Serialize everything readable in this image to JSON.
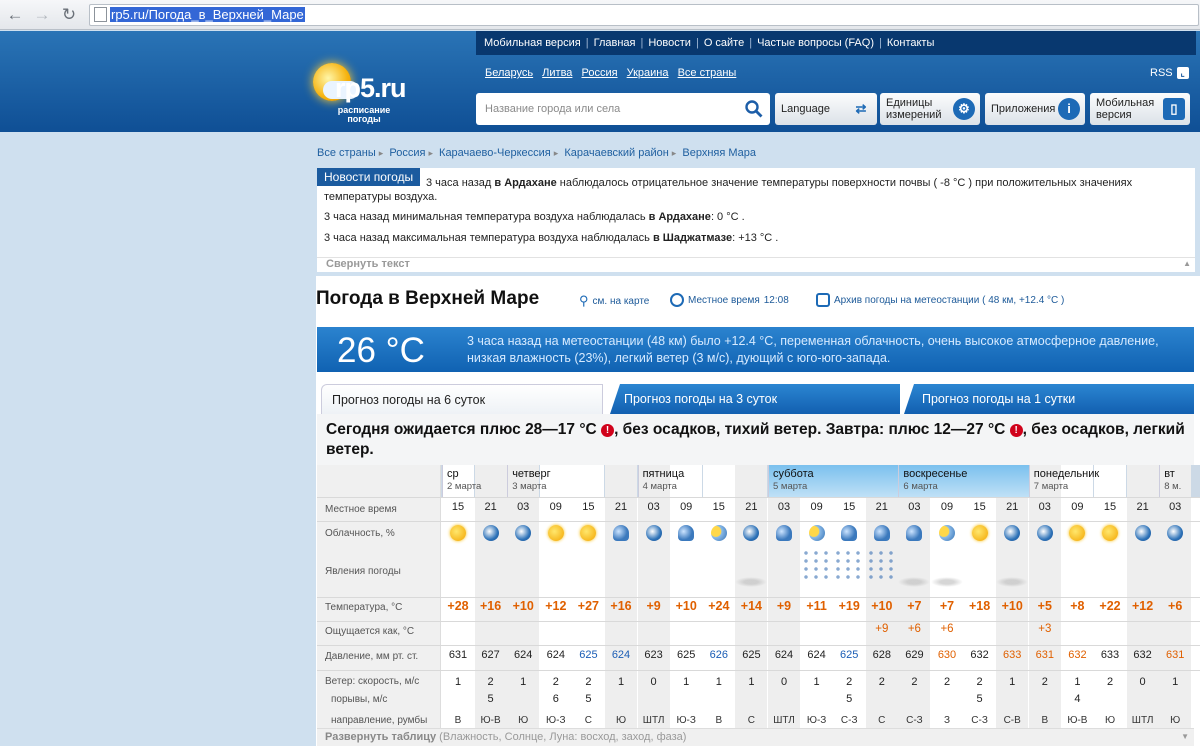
{
  "browser": {
    "url": "rp5.ru/Погода_в_Верхней_Маре"
  },
  "header": {
    "menu": [
      "Мобильная версия",
      "Главная",
      "Новости",
      "О сайте",
      "Частые вопросы (FAQ)",
      "Контакты"
    ],
    "logo": {
      "brand": "rp5.ru",
      "tagline1": "расписание",
      "tagline2": "погоды"
    },
    "countries": [
      "Беларусь",
      "Литва",
      "Россия",
      "Украина",
      "Все страны"
    ],
    "rss": "RSS",
    "search_placeholder": "Название города или села",
    "buttons": {
      "language": "Language",
      "units1": "Единицы",
      "units2": "измерений",
      "apps": "Приложения",
      "mobile1": "Мобильная",
      "mobile2": "версия"
    }
  },
  "breadcrumb": [
    "Все страны",
    "Россия",
    "Карачаево-Черкессия",
    "Карачаевский район",
    "Верхняя Мара"
  ],
  "news": {
    "tag": "Новости погоды",
    "line1a": "3 часа назад ",
    "line1b": "в Ардахане",
    "line1c": " наблюдалось отрицательное значение температуры поверхности почвы ( -8 °C ) при положительных значениях",
    "line1d": "температуры воздуха.",
    "line2a": "3 часа назад минимальная температура воздуха наблюдалась ",
    "line2b": "в Ардахане",
    "line2c": ": 0 °C .",
    "line3a": "3 часа назад максимальная температура воздуха наблюдалась ",
    "line3b": "в Шаджатмазе",
    "line3c": ": +13 °C .",
    "collapse": "Свернуть текст"
  },
  "page": {
    "title": "Погода в Верхней Маре",
    "map_link": "см. на карте",
    "local_time_label": "Местное время",
    "local_time": "12:08",
    "archive": "Архив погоды на метеостанции ( 48 км, +12.4 °C )"
  },
  "now": {
    "temp": "26 °C",
    "text": "3 часа назад на метеостанции (48 км) было +12.4 °C, переменная облачность, очень высокое атмосферное давление, низкая влажность (23%), легкий ветер (3 м/с), дующий с юго-юго-запада."
  },
  "tabs": [
    "Прогноз погоды на 6 суток",
    "Прогноз погоды на 3 суток",
    "Прогноз погоды на 1 сутки"
  ],
  "summary": {
    "p1": "Сегодня ожидается плюс 28—17 °C ",
    "p2": ", без осадков, тихий ветер. Завтра: плюс 12—27 °C ",
    "p3": ", без осадков, легкий ветер.",
    "ex": "!"
  },
  "rows": {
    "time": "Местное время",
    "cloud": "Облачность, %",
    "phen": "Явления погоды",
    "temp": "Температура, °C",
    "feels": "Ощущается как, °C",
    "press": "Давление, мм рт. ст.",
    "wind": "Ветер: скорость, м/с",
    "gust": "порывы, м/с",
    "dir": "направление, румбы"
  },
  "days": [
    {
      "name": "ср",
      "date": "2 марта",
      "hl": false
    },
    {
      "name": "четверг",
      "date": "3 марта",
      "hl": false
    },
    {
      "name": "пятница",
      "date": "4 марта",
      "hl": false
    },
    {
      "name": "суббота",
      "date": "5 марта",
      "hl": true
    },
    {
      "name": "воскресенье",
      "date": "6 марта",
      "hl": true
    },
    {
      "name": "понедельник",
      "date": "7 марта",
      "hl": false
    },
    {
      "name": "вт",
      "date": "8 м.",
      "hl": false
    }
  ],
  "cols": [
    {
      "t": "15",
      "icon": "sun",
      "ph": "",
      "temp": "+28",
      "feels": "",
      "press": "631",
      "pc": "",
      "ws": "1",
      "gs": "",
      "wd": "В",
      "night": false
    },
    {
      "t": "21",
      "icon": "moon",
      "ph": "",
      "temp": "+16",
      "feels": "",
      "press": "627",
      "pc": "",
      "ws": "2",
      "gs": "5",
      "wd": "Ю-В",
      "night": true
    },
    {
      "t": "03",
      "icon": "moon",
      "ph": "",
      "temp": "+10",
      "feels": "",
      "press": "624",
      "pc": "",
      "ws": "1",
      "gs": "",
      "wd": "Ю",
      "night": true
    },
    {
      "t": "09",
      "icon": "sun",
      "ph": "",
      "temp": "+12",
      "feels": "",
      "press": "624",
      "pc": "",
      "ws": "2",
      "gs": "6",
      "wd": "Ю-З",
      "night": false
    },
    {
      "t": "15",
      "icon": "sun",
      "ph": "",
      "temp": "+27",
      "feels": "",
      "press": "625",
      "pc": "blue",
      "ws": "2",
      "gs": "5",
      "wd": "С",
      "night": false
    },
    {
      "t": "21",
      "icon": "cloudy",
      "ph": "",
      "temp": "+16",
      "feels": "",
      "press": "624",
      "pc": "blue",
      "ws": "1",
      "gs": "",
      "wd": "Ю",
      "night": true
    },
    {
      "t": "03",
      "icon": "moon",
      "ph": "",
      "temp": "+9",
      "feels": "",
      "press": "623",
      "pc": "",
      "ws": "0",
      "gs": "",
      "wd": "ШТЛ",
      "night": true
    },
    {
      "t": "09",
      "icon": "cloudy",
      "ph": "",
      "temp": "+10",
      "feels": "",
      "press": "625",
      "pc": "",
      "ws": "1",
      "gs": "",
      "wd": "Ю-З",
      "night": false
    },
    {
      "t": "15",
      "icon": "psun",
      "ph": "",
      "temp": "+24",
      "feels": "",
      "press": "626",
      "pc": "blue",
      "ws": "1",
      "gs": "",
      "wd": "В",
      "night": false
    },
    {
      "t": "21",
      "icon": "moon",
      "ph": "fog",
      "temp": "+14",
      "feels": "",
      "press": "625",
      "pc": "",
      "ws": "1",
      "gs": "",
      "wd": "С",
      "night": true
    },
    {
      "t": "03",
      "icon": "cloudy",
      "ph": "",
      "temp": "+9",
      "feels": "",
      "press": "624",
      "pc": "",
      "ws": "0",
      "gs": "",
      "wd": "ШТЛ",
      "night": true
    },
    {
      "t": "09",
      "icon": "psun",
      "ph": "snow",
      "temp": "+11",
      "feels": "",
      "press": "624",
      "pc": "",
      "ws": "1",
      "gs": "",
      "wd": "Ю-З",
      "night": false
    },
    {
      "t": "15",
      "icon": "cloudy",
      "ph": "snow",
      "temp": "+19",
      "feels": "",
      "press": "625",
      "pc": "blue",
      "ws": "2",
      "gs": "5",
      "wd": "С-З",
      "night": false
    },
    {
      "t": "21",
      "icon": "cloudy",
      "ph": "snow",
      "temp": "+10",
      "feels": "+9",
      "press": "628",
      "pc": "",
      "ws": "2",
      "gs": "",
      "wd": "С",
      "night": true
    },
    {
      "t": "03",
      "icon": "cloudy",
      "ph": "fog",
      "temp": "+7",
      "feels": "+6",
      "press": "629",
      "pc": "",
      "ws": "2",
      "gs": "",
      "wd": "С-З",
      "night": true
    },
    {
      "t": "09",
      "icon": "psun",
      "ph": "fog",
      "temp": "+7",
      "feels": "+6",
      "press": "630",
      "pc": "org",
      "ws": "2",
      "gs": "",
      "wd": "З",
      "night": false
    },
    {
      "t": "15",
      "icon": "sun",
      "ph": "",
      "temp": "+18",
      "feels": "",
      "press": "632",
      "pc": "",
      "ws": "2",
      "gs": "5",
      "wd": "С-З",
      "night": false
    },
    {
      "t": "21",
      "icon": "moon",
      "ph": "fog",
      "temp": "+10",
      "feels": "",
      "press": "633",
      "pc": "org",
      "ws": "1",
      "gs": "",
      "wd": "С-В",
      "night": true
    },
    {
      "t": "03",
      "icon": "moon",
      "ph": "",
      "temp": "+5",
      "feels": "+3",
      "press": "631",
      "pc": "org",
      "ws": "2",
      "gs": "",
      "wd": "В",
      "night": true
    },
    {
      "t": "09",
      "icon": "sun",
      "ph": "",
      "temp": "+8",
      "feels": "",
      "press": "632",
      "pc": "org",
      "ws": "1",
      "gs": "4",
      "wd": "Ю-В",
      "night": false
    },
    {
      "t": "15",
      "icon": "sun",
      "ph": "",
      "temp": "+22",
      "feels": "",
      "press": "633",
      "pc": "",
      "ws": "2",
      "gs": "",
      "wd": "Ю",
      "night": false
    },
    {
      "t": "21",
      "icon": "moon",
      "ph": "",
      "temp": "+12",
      "feels": "",
      "press": "632",
      "pc": "",
      "ws": "0",
      "gs": "",
      "wd": "ШТЛ",
      "night": true
    },
    {
      "t": "03",
      "icon": "moon",
      "ph": "",
      "temp": "+6",
      "feels": "",
      "press": "631",
      "pc": "org",
      "ws": "1",
      "gs": "",
      "wd": "Ю",
      "night": true
    }
  ],
  "expand": {
    "bold": "Развернуть таблицу",
    "rest": " (Влажность, Солнце, Луна: восход, заход, фаза)"
  }
}
